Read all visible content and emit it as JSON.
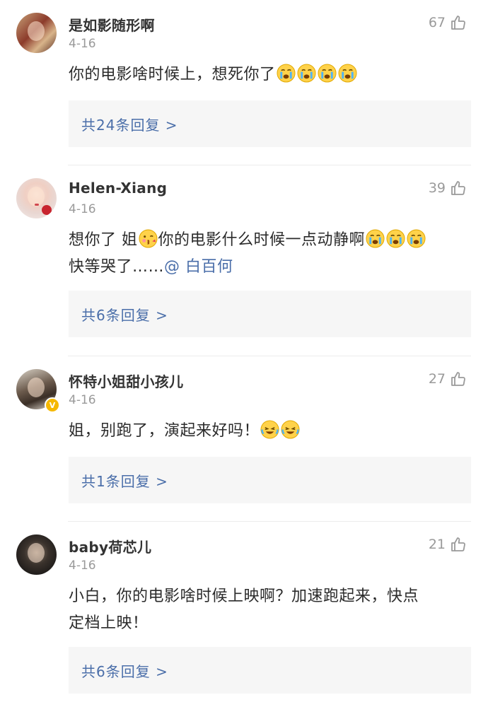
{
  "comments": [
    {
      "username": "是如影随形啊",
      "date": "4-16",
      "likes": "67",
      "text_before": "你的电影啥时候上，想死你了",
      "emojis_after": [
        "crying-emoji",
        "crying-emoji",
        "crying-emoji",
        "crying-emoji"
      ],
      "replies": "共24条回复 >"
    },
    {
      "username": "Helen-Xiang",
      "date": "4-16",
      "likes": "39",
      "text_part1": "想你了 姐",
      "text_part2": "你的电影什么时候一点动静啊",
      "text_part3": "快等哭了……",
      "mention": "@ 白百何",
      "replies": "共6条回复 >"
    },
    {
      "username": "怀特小姐甜小孩儿",
      "date": "4-16",
      "likes": "27",
      "verified_badge": "V",
      "text_before": "姐，别跑了，演起来好吗！",
      "emojis_after": [
        "laugh-cry-emoji",
        "laugh-cry-emoji"
      ],
      "replies": "共1条回复 >"
    },
    {
      "username": "baby荷芯儿",
      "date": "4-16",
      "likes": "21",
      "text_line1": "小白，你的电影啥时候上映啊？加速跑起来，快点",
      "text_line2": "定档上映！",
      "replies": "共6条回复 >"
    }
  ],
  "colors": {
    "link": "#4a6ea9",
    "meta": "#9a9a9a",
    "reply_bg": "#f6f6f6"
  },
  "icons": {
    "like": "thumbs-up-icon"
  }
}
